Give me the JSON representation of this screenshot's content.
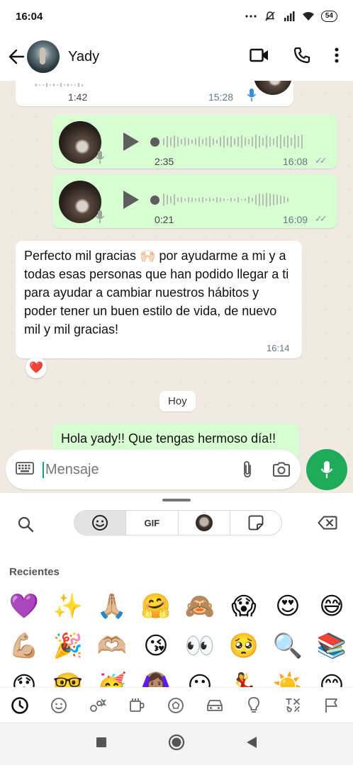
{
  "status_bar": {
    "time": "16:04",
    "battery": "54"
  },
  "header": {
    "contact_name": "Yady"
  },
  "messages": [
    {
      "type": "voice",
      "direction": "in",
      "duration": "1:42",
      "time": "15:28"
    },
    {
      "type": "voice",
      "direction": "out",
      "duration": "2:35",
      "time": "16:08",
      "status": "read"
    },
    {
      "type": "voice",
      "direction": "out",
      "duration": "0:21",
      "time": "16:09",
      "status": "read"
    },
    {
      "type": "text",
      "direction": "in",
      "text": "Perfecto mil gracias 🙌🏻 por ayudarme a mi y a todas esas personas que han podido llegar a ti para ayudar a cambiar nuestros hábitos y poder tener un buen estilo de vida, de nuevo mil y mil gracias!",
      "time": "16:14",
      "reaction": "❤️"
    },
    {
      "type": "date_chip",
      "text": "Hoy"
    },
    {
      "type": "text",
      "direction": "out",
      "text": "Hola yady!! Que tengas hermoso día!!"
    }
  ],
  "input": {
    "placeholder": "Mensaje"
  },
  "keyboard": {
    "tabs": [
      {
        "name": "emoji",
        "label": "",
        "active": true
      },
      {
        "name": "gif",
        "label": "GIF",
        "active": false
      },
      {
        "name": "avatar-stickers",
        "label": "",
        "active": false
      },
      {
        "name": "stickers",
        "label": "",
        "active": false
      }
    ],
    "section_label": "Recientes",
    "recent_emojis": [
      "💜",
      "✨",
      "🙏🏼",
      "🤗",
      "🙈",
      "😱",
      "😍",
      "😅",
      "💪🏼",
      "🎉",
      "🫶🏼",
      "😘",
      "👀",
      "🥺",
      "🔍",
      "📚",
      "😯",
      "🤓",
      "🥳",
      "🙆🏽‍♀️",
      "😐",
      "💃",
      "☀️",
      "😊"
    ],
    "categories": [
      "recent",
      "smileys",
      "animals-nature",
      "food-drink",
      "activities",
      "travel",
      "objects",
      "symbols",
      "flags"
    ]
  },
  "colors": {
    "outgoing_bubble": "#d9fdd3",
    "incoming_bubble": "#ffffff",
    "chat_bg": "#efeae2",
    "accent": "#1fab59"
  }
}
